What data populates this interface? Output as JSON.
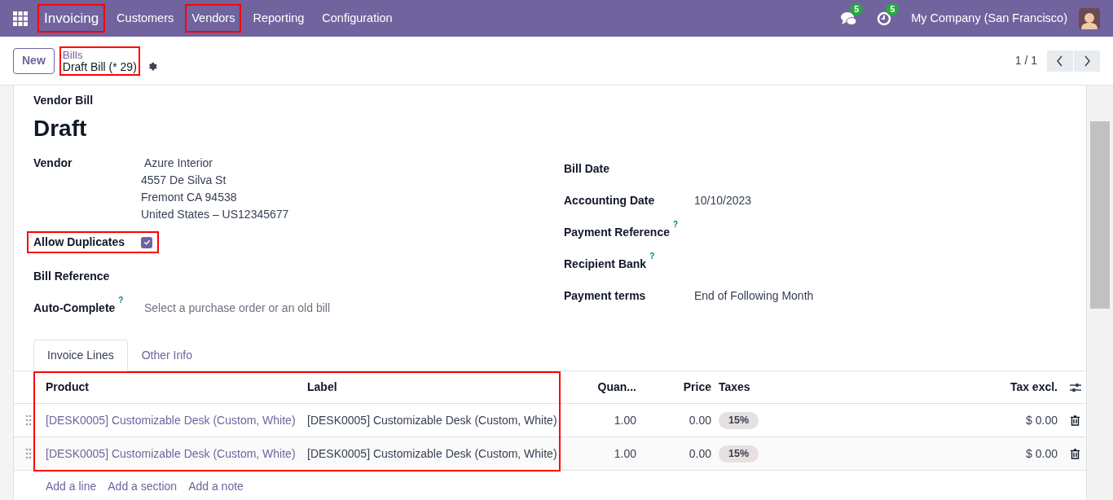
{
  "navbar": {
    "app_name": {
      "text": "Invoicing",
      "highlighted": true
    },
    "menu": [
      {
        "label": "Customers",
        "highlighted": false
      },
      {
        "label": "Vendors",
        "highlighted": true
      },
      {
        "label": "Reporting",
        "highlighted": false
      },
      {
        "label": "Configuration",
        "highlighted": false
      }
    ],
    "messages_count": "5",
    "activities_count": "5",
    "company": "My Company (San Francisco)"
  },
  "control_panel": {
    "new_button": "New",
    "breadcrumb": {
      "parent": "Bills",
      "current": "Draft Bill (* 29)",
      "highlighted": true
    },
    "pager": "1 / 1"
  },
  "form": {
    "type_label": "Vendor Bill",
    "status": "Draft",
    "left_fields": [
      {
        "kind": "address",
        "label": "Vendor",
        "name": "Azure Interior",
        "lines": [
          "4557 De Silva St",
          "Fremont CA 94538",
          "United States – US12345677"
        ]
      },
      {
        "kind": "checkbox",
        "label": "Allow Duplicates",
        "checked": true,
        "highlighted": true
      },
      {
        "kind": "text",
        "label": "Bill Reference"
      },
      {
        "kind": "select",
        "label": "Auto-Complete",
        "help": "?",
        "placeholder": "Select a purchase order or an old bill"
      }
    ],
    "right_fields": [
      {
        "label": "Bill Date"
      },
      {
        "label": "Accounting Date",
        "value": "10/10/2023"
      },
      {
        "label": "Payment Reference",
        "help": "?"
      },
      {
        "label": "Recipient Bank",
        "help": "?"
      },
      {
        "label": "Payment terms",
        "value": "End of Following Month"
      }
    ]
  },
  "tabs": [
    {
      "label": "Invoice Lines",
      "selected": true
    },
    {
      "label": "Other Info",
      "selected": false
    }
  ],
  "table": {
    "columns": [
      {
        "label": "Product",
        "highlighted": true
      },
      {
        "label": "Label",
        "highlighted": true
      },
      {
        "label": "Quan...",
        "highlighted": false
      },
      {
        "label": "Price",
        "highlighted": false
      },
      {
        "label": "Taxes",
        "highlighted": false
      },
      {
        "label": "Tax excl.",
        "highlighted": false
      }
    ],
    "rows": [
      {
        "product": "[DESK0005] Customizable Desk (Custom, White)",
        "label": "[DESK0005] Customizable Desk (Custom, White)",
        "quantity": "1.00",
        "price": "0.00",
        "tax": "15%",
        "subtotal": "$ 0.00"
      },
      {
        "product": "[DESK0005] Customizable Desk (Custom, White)",
        "label": "[DESK0005] Customizable Desk (Custom, White)",
        "quantity": "1.00",
        "price": "0.00",
        "tax": "15%",
        "subtotal": "$ 0.00"
      }
    ],
    "actions": [
      "Add a line",
      "Add a section",
      "Add a note"
    ]
  }
}
